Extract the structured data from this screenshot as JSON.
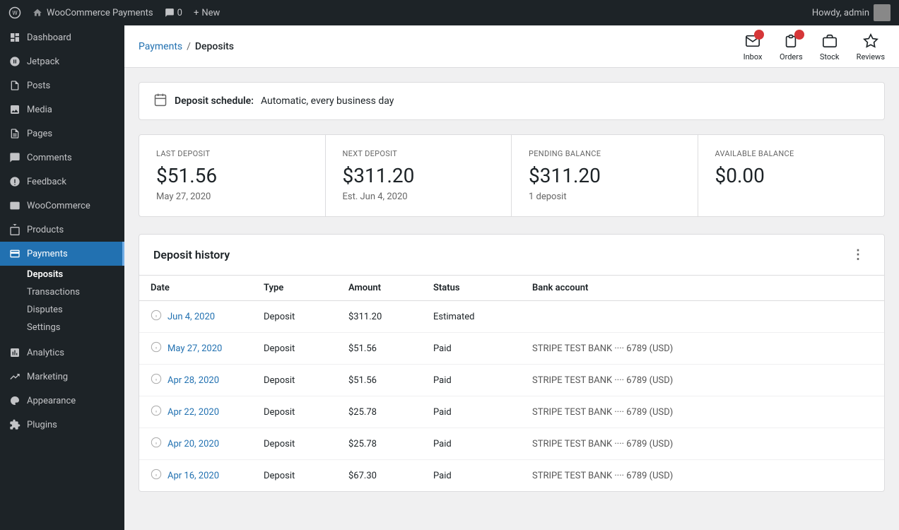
{
  "topbar": {
    "logo_label": "WordPress",
    "site_name": "WooCommerce Payments",
    "comments_count": "0",
    "new_label": "New",
    "howdy_label": "Howdy, admin"
  },
  "sidebar": {
    "items": [
      {
        "id": "dashboard",
        "label": "Dashboard",
        "icon": "dashboard"
      },
      {
        "id": "jetpack",
        "label": "Jetpack",
        "icon": "jetpack"
      },
      {
        "id": "posts",
        "label": "Posts",
        "icon": "posts"
      },
      {
        "id": "media",
        "label": "Media",
        "icon": "media"
      },
      {
        "id": "pages",
        "label": "Pages",
        "icon": "pages"
      },
      {
        "id": "comments",
        "label": "Comments",
        "icon": "comments"
      },
      {
        "id": "feedback",
        "label": "Feedback",
        "icon": "feedback"
      },
      {
        "id": "woocommerce",
        "label": "WooCommerce",
        "icon": "woocommerce"
      },
      {
        "id": "products",
        "label": "Products",
        "icon": "products"
      },
      {
        "id": "payments",
        "label": "Payments",
        "icon": "payments",
        "active": true
      },
      {
        "id": "analytics",
        "label": "Analytics",
        "icon": "analytics"
      },
      {
        "id": "marketing",
        "label": "Marketing",
        "icon": "marketing"
      },
      {
        "id": "appearance",
        "label": "Appearance",
        "icon": "appearance"
      },
      {
        "id": "plugins",
        "label": "Plugins",
        "icon": "plugins"
      }
    ],
    "payments_subitems": [
      {
        "id": "deposits",
        "label": "Deposits",
        "active": true
      },
      {
        "id": "transactions",
        "label": "Transactions"
      },
      {
        "id": "disputes",
        "label": "Disputes"
      },
      {
        "id": "settings",
        "label": "Settings"
      }
    ]
  },
  "header": {
    "breadcrumb_link": "Payments",
    "breadcrumb_sep": "/",
    "breadcrumb_current": "Deposits",
    "actions": [
      {
        "id": "inbox",
        "label": "Inbox",
        "badge": true
      },
      {
        "id": "orders",
        "label": "Orders",
        "badge": true
      },
      {
        "id": "stock",
        "label": "Stock"
      },
      {
        "id": "reviews",
        "label": "Reviews"
      }
    ]
  },
  "deposit_schedule": {
    "label": "Deposit schedule:",
    "value": "Automatic, every business day"
  },
  "stats": [
    {
      "id": "last-deposit",
      "label": "LAST DEPOSIT",
      "value": "$51.56",
      "sub": "May 27, 2020"
    },
    {
      "id": "next-deposit",
      "label": "NEXT DEPOSIT",
      "value": "$311.20",
      "sub": "Est. Jun 4, 2020"
    },
    {
      "id": "pending-balance",
      "label": "PENDING BALANCE",
      "value": "$311.20",
      "sub": "1 deposit"
    },
    {
      "id": "available-balance",
      "label": "AVAILABLE BALANCE",
      "value": "$0.00",
      "sub": ""
    }
  ],
  "deposit_history": {
    "title": "Deposit history",
    "columns": [
      "Date",
      "Type",
      "Amount",
      "Status",
      "Bank account"
    ],
    "rows": [
      {
        "date": "Jun 4, 2020",
        "type": "Deposit",
        "amount": "$311.20",
        "status": "Estimated",
        "bank": ""
      },
      {
        "date": "May 27, 2020",
        "type": "Deposit",
        "amount": "$51.56",
        "status": "Paid",
        "bank": "STRIPE TEST BANK ···· 6789 (USD)"
      },
      {
        "date": "Apr 28, 2020",
        "type": "Deposit",
        "amount": "$51.56",
        "status": "Paid",
        "bank": "STRIPE TEST BANK ···· 6789 (USD)"
      },
      {
        "date": "Apr 22, 2020",
        "type": "Deposit",
        "amount": "$25.78",
        "status": "Paid",
        "bank": "STRIPE TEST BANK ···· 6789 (USD)"
      },
      {
        "date": "Apr 20, 2020",
        "type": "Deposit",
        "amount": "$25.78",
        "status": "Paid",
        "bank": "STRIPE TEST BANK ···· 6789 (USD)"
      },
      {
        "date": "Apr 16, 2020",
        "type": "Deposit",
        "amount": "$67.30",
        "status": "Paid",
        "bank": "STRIPE TEST BANK ···· 6789 (USD)"
      }
    ]
  }
}
